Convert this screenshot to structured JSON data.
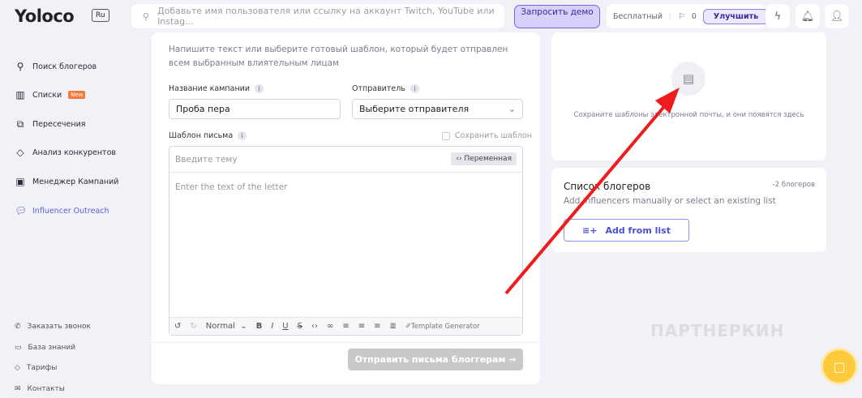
{
  "header": {
    "logo": "Yoloco",
    "lang": "Ru",
    "search_placeholder": "Добавьте имя пользователя или ссылку на аккаунт Twitch, YouTube или Instag...",
    "demo_button": "Запросить демо",
    "plan": "Бесплатный",
    "flags_count": "0",
    "upgrade_button": "Улучшить"
  },
  "sidebar": {
    "items": [
      {
        "label": "Поиск блогеров",
        "icon": "search-icon"
      },
      {
        "label": "Списки",
        "badge": "New",
        "icon": "chart-icon"
      },
      {
        "label": "Пересечения",
        "icon": "copy-icon"
      },
      {
        "label": "Анализ конкурентов",
        "icon": "tag-icon"
      },
      {
        "label": "Менеджер Кампаний",
        "icon": "user-card-icon"
      },
      {
        "label": "Influencer Outreach",
        "icon": "chat-icon",
        "active": true
      }
    ],
    "bottom": [
      {
        "label": "Заказать звонок",
        "icon": "phone-icon"
      },
      {
        "label": "База знаний",
        "icon": "message-icon"
      },
      {
        "label": "Тарифы",
        "icon": "tag-icon"
      },
      {
        "label": "Контакты",
        "icon": "mail-icon"
      }
    ]
  },
  "form": {
    "intro": "Напишите текст или выберите готовый шаблон, который будет отправлен всем выбранным влиятельным лицам",
    "campaign_label": "Название кампании",
    "campaign_value": "Проба пера",
    "sender_label": "Отправитель",
    "sender_placeholder": "Выберите отправителя",
    "template_label": "Шаблон письма",
    "save_template": "Сохранить шаблон",
    "subject_placeholder": "Введите тему",
    "variable_button": "Переменная",
    "body_placeholder": "Enter the text of the letter",
    "format": "Normal",
    "template_generator": "Template Generator",
    "send_button": "Отправить письма блоггерам →"
  },
  "templates": {
    "empty_text": "Сохраните шаблоны электронной почты, и они появятся здесь"
  },
  "bloggers": {
    "title": "Список блогеров",
    "count": "-2 блогеров",
    "subtitle": "Add influencers manually or select an existing list",
    "add_button": "Add from list"
  },
  "watermark": "ПАРТНЕРКИН",
  "colors": {
    "accent": "#5b5fd6",
    "arrow": "#ee1c1c",
    "chat": "#ffc93c"
  }
}
